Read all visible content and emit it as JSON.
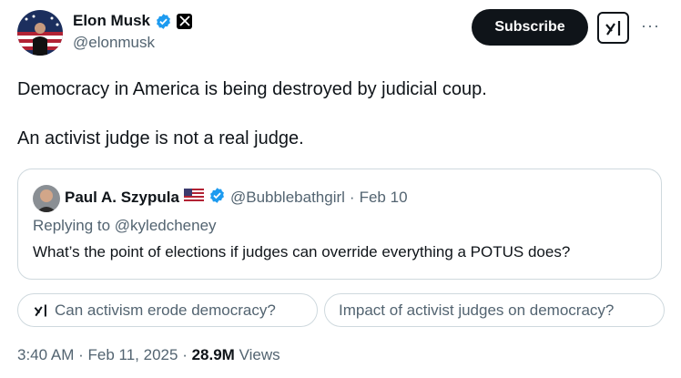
{
  "author": {
    "name": "Elon Musk",
    "handle": "@elonmusk",
    "verified_badge": "verified-badge-icon",
    "affiliation_icon": "x-logo-icon"
  },
  "header_actions": {
    "subscribe_label": "Subscribe",
    "grok_icon": "grok-icon",
    "more_label": "···"
  },
  "tweet": {
    "paragraphs": [
      "Democracy in America is being destroyed by judicial coup.",
      "An activist judge is not a real judge."
    ]
  },
  "quote": {
    "name": "Paul A. Szypula",
    "flag_icon": "us-flag-icon",
    "handle": "@Bubblebathgirl",
    "separator": "·",
    "date": "Feb 10",
    "replying_prefix": "Replying to ",
    "replying_handle": "@kyledcheney",
    "text": "What’s the point of elections if judges can override everything a POTUS does?"
  },
  "grok_suggestions": [
    {
      "label": "Can activism erode democracy?",
      "icon": "grok-icon"
    },
    {
      "label": "Impact of activist judges on democracy?"
    }
  ],
  "footer": {
    "time": "3:40 AM",
    "sep1": "·",
    "date": "Feb 11, 2025",
    "sep2": "·",
    "views_count": "28.9M",
    "views_label": "Views"
  },
  "colors": {
    "text": "#0f1419",
    "secondary": "#536471",
    "verified": "#1d9bf0",
    "border": "#cfd9de"
  }
}
